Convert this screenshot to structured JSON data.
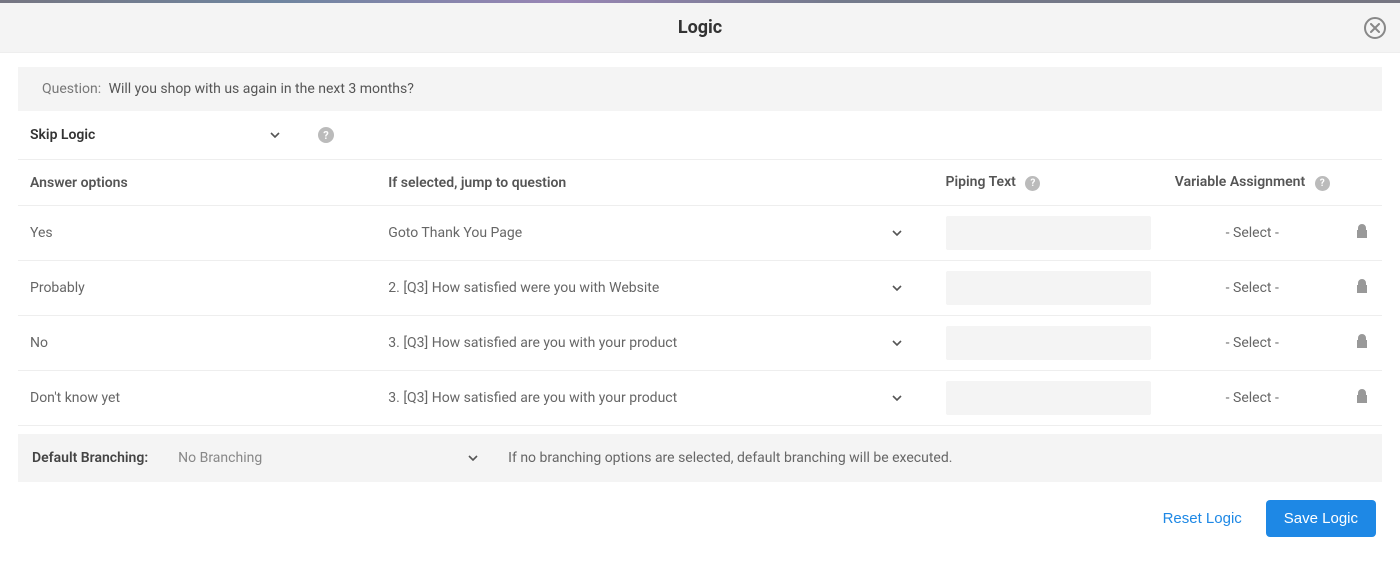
{
  "modal": {
    "title": "Logic"
  },
  "question": {
    "label": "Question:",
    "text": "Will you shop with us again in the next 3 months?"
  },
  "logicType": {
    "selected": "Skip Logic"
  },
  "columns": {
    "answer": "Answer options",
    "jump": "If selected, jump to question",
    "piping": "Piping Text",
    "variable": "Variable Assignment"
  },
  "rows": [
    {
      "answer": "Yes",
      "jump": "Goto Thank You Page",
      "piping": "",
      "variable": "- Select -"
    },
    {
      "answer": "Probably",
      "jump": "2. [Q3] How satisfied were you with Website",
      "piping": "",
      "variable": "- Select -"
    },
    {
      "answer": "No",
      "jump": "3. [Q3] How satisfied are you with your product",
      "piping": "",
      "variable": "- Select -"
    },
    {
      "answer": "Don't know yet",
      "jump": "3. [Q3] How satisfied are you with your product",
      "piping": "",
      "variable": "- Select -"
    }
  ],
  "defaultBranching": {
    "label": "Default Branching:",
    "selected": "No Branching",
    "hint": "If no branching options are selected, default branching will be executed."
  },
  "actions": {
    "reset": "Reset Logic",
    "save": "Save Logic"
  }
}
